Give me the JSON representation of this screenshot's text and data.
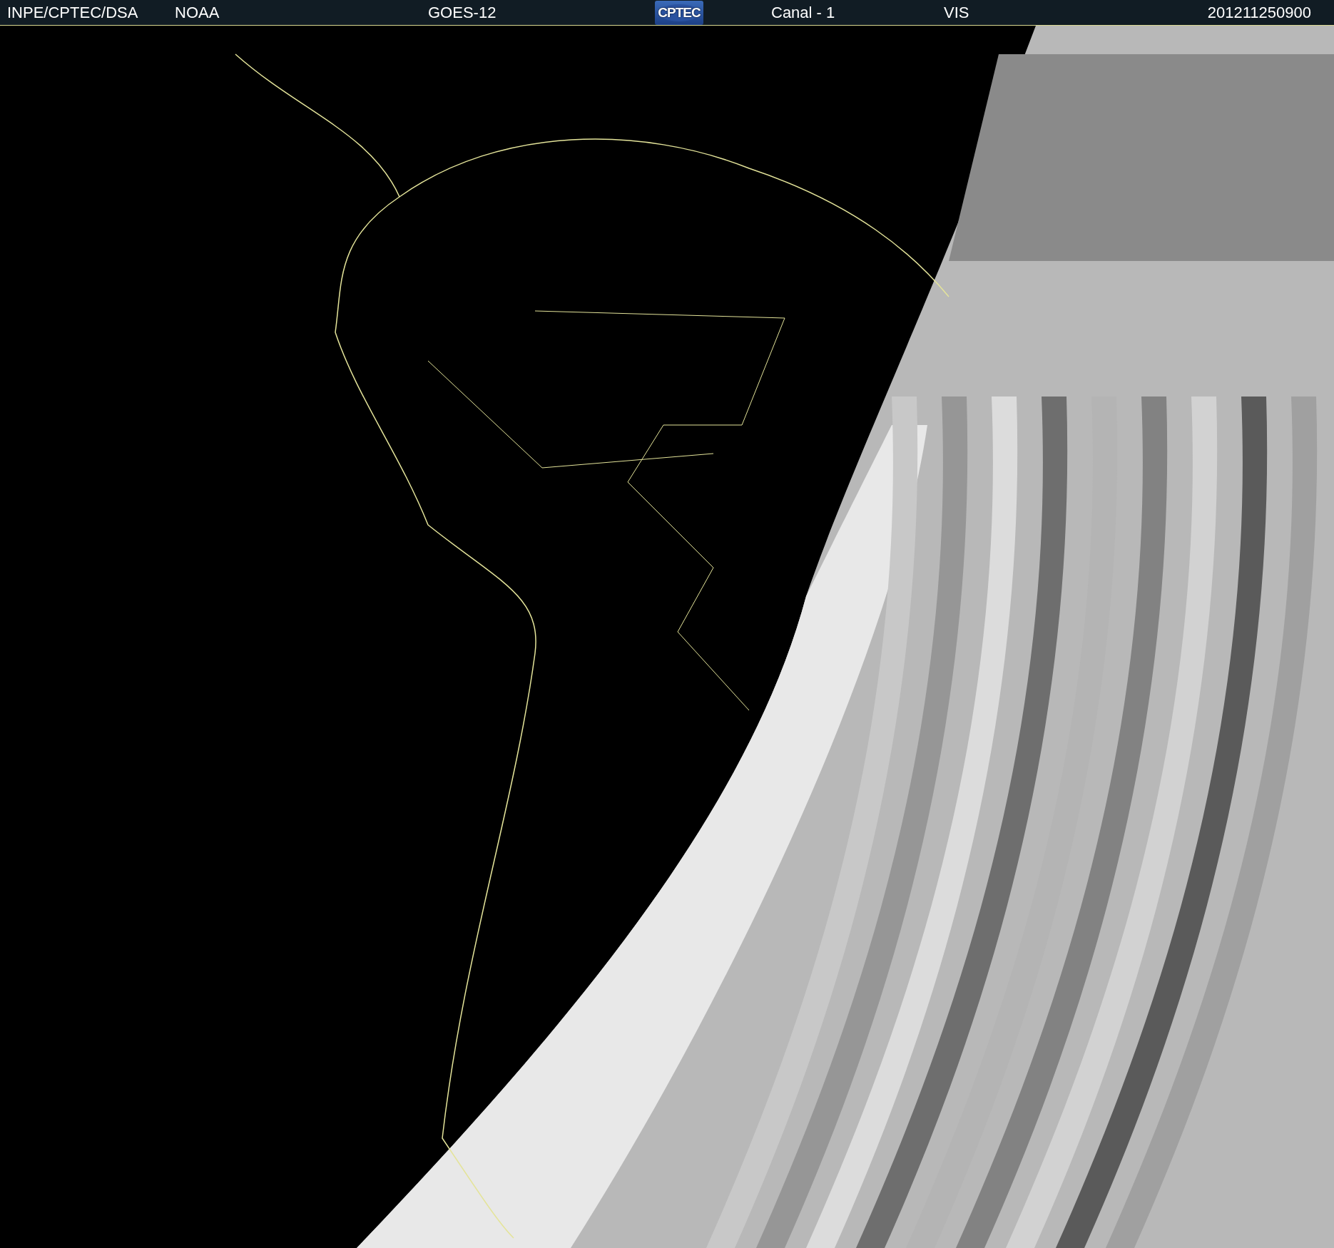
{
  "header": {
    "source": "INPE/CPTEC/DSA",
    "agency": "NOAA",
    "satellite": "GOES-12",
    "logo": "CPTEC",
    "channel": "Canal - 1",
    "band": "VIS",
    "timestamp": "201211250900"
  }
}
